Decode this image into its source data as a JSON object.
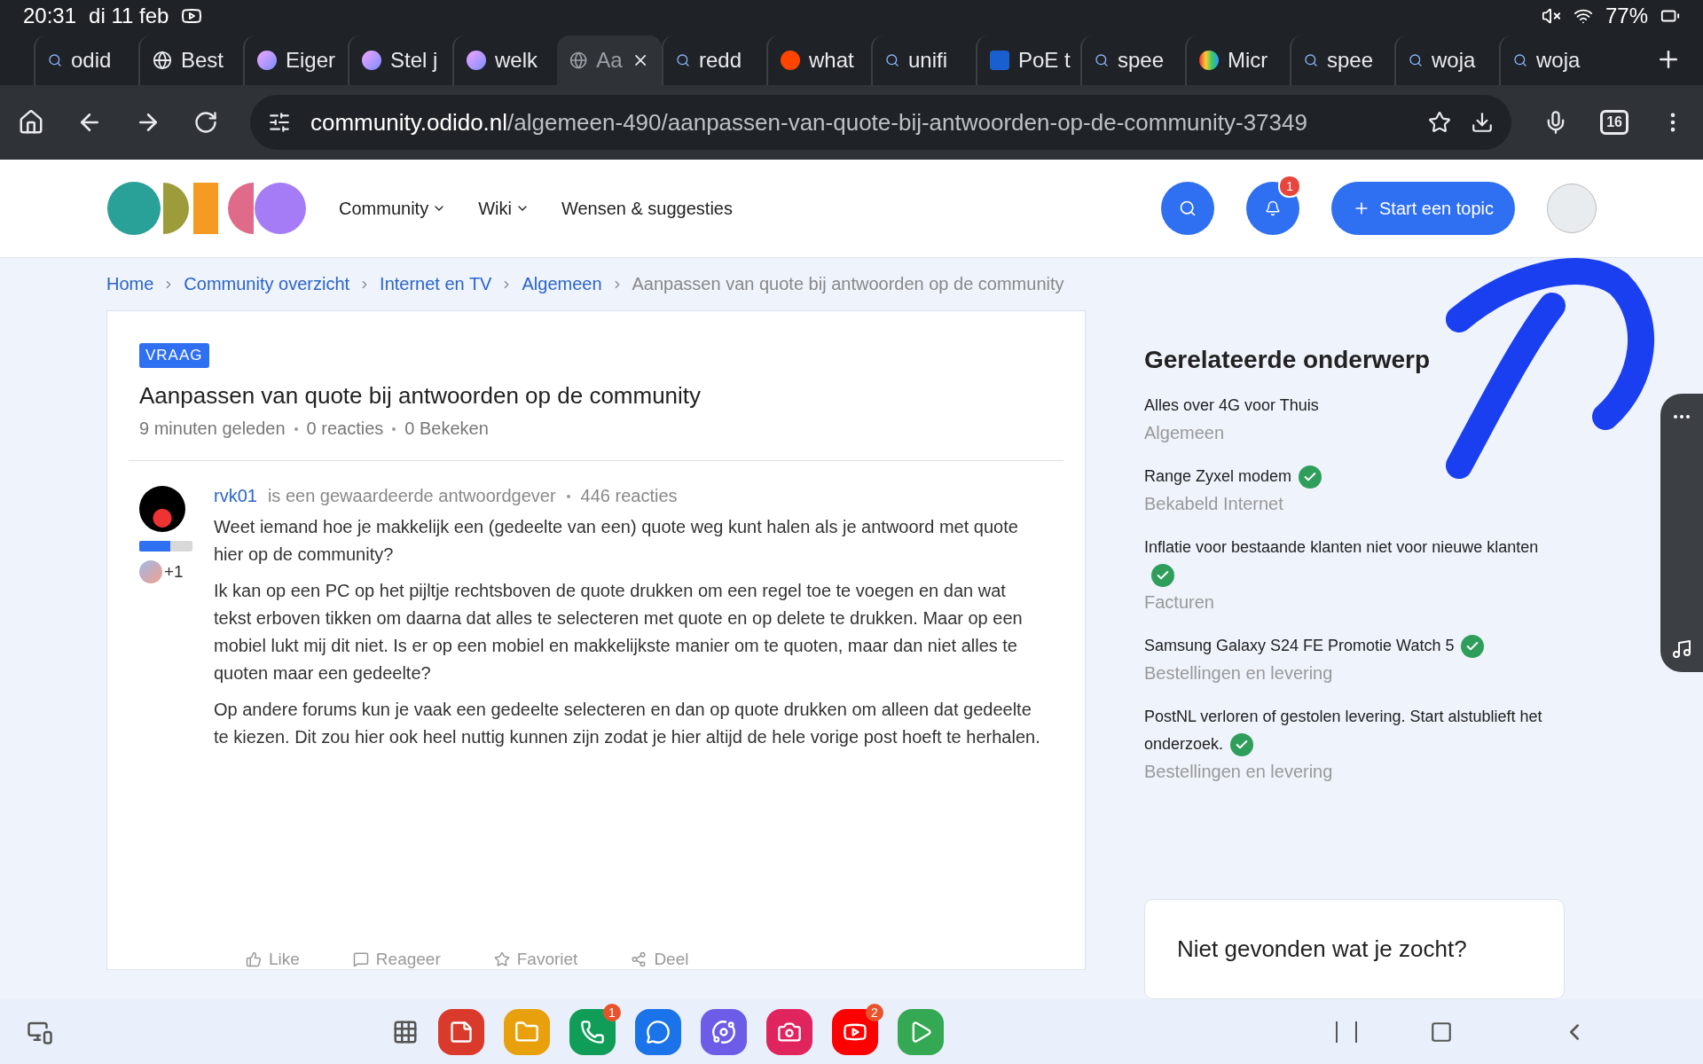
{
  "status_bar": {
    "time": "20:31",
    "date": "di 11 feb",
    "battery": "77%"
  },
  "tabs": [
    {
      "label": "odid",
      "kind": "search",
      "selected": false
    },
    {
      "label": "Best",
      "kind": "globe",
      "selected": false
    },
    {
      "label": "Eiger",
      "kind": "orb",
      "selected": false
    },
    {
      "label": "Stel j",
      "kind": "orb",
      "selected": false
    },
    {
      "label": "welk",
      "kind": "orb",
      "selected": false
    },
    {
      "label": "Aa",
      "kind": "globe",
      "selected": true
    },
    {
      "label": "redd",
      "kind": "search",
      "selected": false
    },
    {
      "label": "what",
      "kind": "reddit",
      "selected": false
    },
    {
      "label": "unifi",
      "kind": "search",
      "selected": false
    },
    {
      "label": "PoE t",
      "kind": "shield",
      "selected": false
    },
    {
      "label": "spee",
      "kind": "search",
      "selected": false
    },
    {
      "label": "Micr",
      "kind": "rainbow",
      "selected": false
    },
    {
      "label": "spee",
      "kind": "search",
      "selected": false
    },
    {
      "label": "woja",
      "kind": "search",
      "selected": false
    },
    {
      "label": "woja",
      "kind": "search",
      "selected": false
    }
  ],
  "address_bar": {
    "host": "community.odido.nl",
    "path": "/algemeen-490/aanpassen-van-quote-bij-antwoorden-op-de-community-37349",
    "tab_count": "16"
  },
  "site_header": {
    "nav": [
      {
        "label": "Community",
        "dropdown": true
      },
      {
        "label": "Wiki",
        "dropdown": true
      },
      {
        "label": "Wensen & suggesties",
        "dropdown": false
      }
    ],
    "notification_count": "1",
    "start_button": "Start een topic"
  },
  "breadcrumbs": [
    {
      "label": "Home",
      "current": false
    },
    {
      "label": "Community overzicht",
      "current": false
    },
    {
      "label": "Internet en TV",
      "current": false
    },
    {
      "label": "Algemeen",
      "current": false
    },
    {
      "label": "Aanpassen van quote bij antwoorden op de community",
      "current": true
    }
  ],
  "post": {
    "tag": "VRAAG",
    "title": "Aanpassen van quote bij antwoorden op de community",
    "meta": [
      "9 minuten geleden",
      "0 reacties",
      "0 Bekeken"
    ],
    "author": {
      "name": "rvk01",
      "rank": "is een gewaardeerde antwoordgever",
      "reactions": "446 reacties",
      "rank_bar": {
        "level": 0.58
      },
      "badge_count": "+1"
    },
    "paragraphs": [
      "Weet iemand hoe je makkelijk een (gedeelte van een) quote weg kunt halen als je antwoord met quote hier op de community?",
      "Ik kan op een PC op het pijltje rechtsboven de quote drukken om een regel toe te voegen en dan wat tekst erboven tikken om daarna dat alles te selecteren met quote en op delete te drukken. Maar op een mobiel lukt mij dit niet. Is er op een mobiel en makkelijkste manier om te quoten, maar dan niet alles te quoten maar een gedeelte?",
      "Op andere forums kun je vaak een gedeelte selecteren en dan op quote drukken om alleen dat gedeelte te kiezen. Dit zou hier ook heel nuttig kunnen zijn zodat je hier altijd de hele vorige post hoeft te herhalen."
    ],
    "actions": [
      {
        "label": "Like",
        "kind": "like"
      },
      {
        "label": "Reageer",
        "kind": "reply"
      },
      {
        "label": "Favoriet",
        "kind": "favorite"
      },
      {
        "label": "Deel",
        "kind": "share"
      }
    ]
  },
  "related": {
    "title": "Gerelateerde onderwerp",
    "items": [
      {
        "title": "Alles over 4G voor Thuis",
        "solved": false,
        "category": "Algemeen"
      },
      {
        "title": "Range Zyxel modem",
        "solved": true,
        "category": "Bekabeld Internet"
      },
      {
        "title": "Inflatie voor bestaande klanten niet voor nieuwe klanten",
        "solved": true,
        "category": "Facturen"
      },
      {
        "title": "Samsung Galaxy S24 FE Promotie Watch 5",
        "solved": true,
        "category": "Bestellingen en levering"
      },
      {
        "title": "PostNL verloren of gestolen levering. Start alstublieft het onderzoek.",
        "solved": true,
        "category": "Bestellingen en levering"
      }
    ]
  },
  "help_card": {
    "title": "Niet gevonden wat je zocht?"
  },
  "taskbar": {
    "apps": [
      {
        "kind": "notes",
        "color": "#d93a2b"
      },
      {
        "kind": "files",
        "color": "#e8a10c"
      },
      {
        "kind": "phone",
        "color": "#0f9d58",
        "badge": "1"
      },
      {
        "kind": "messages",
        "color": "#1a73e8"
      },
      {
        "kind": "internet",
        "color": "#6c5ce7"
      },
      {
        "kind": "camera",
        "color": "#e0245e"
      },
      {
        "kind": "youtube",
        "color": "#ff0000",
        "badge": "2"
      },
      {
        "kind": "play",
        "color": "#34a853"
      }
    ]
  }
}
